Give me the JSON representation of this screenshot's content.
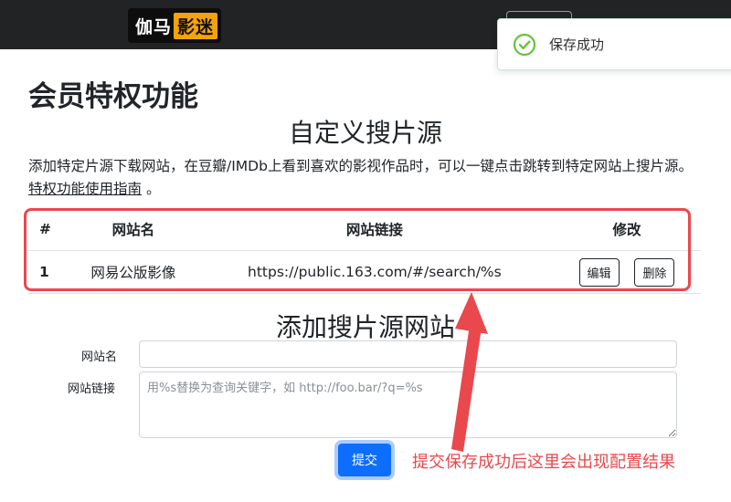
{
  "navbar": {
    "logo_part1": "伽马",
    "logo_part2": "影迷"
  },
  "toast": {
    "message": "保存成功",
    "icon": "check-circle-icon",
    "color": "#67c23a"
  },
  "page": {
    "title": "会员特权功能",
    "section_title": "自定义搜片源",
    "description": "添加特定片源下载网站，在豆瓣/IMDb上看到喜欢的影视作品时，可以一键点击跳转到特定网站上搜片源。",
    "guide_link": "特权功能使用指南",
    "guide_suffix": "。"
  },
  "table": {
    "headers": [
      "#",
      "网站名",
      "网站链接",
      "修改"
    ],
    "rows": [
      {
        "num": "1",
        "name": "网易公版影像",
        "url": "https://public.163.com/#/search/%s",
        "edit": "编辑",
        "delete": "删除"
      }
    ]
  },
  "form": {
    "title": "添加搜片源网站",
    "name_label": "网站名",
    "name_value": "",
    "url_label": "网站链接",
    "url_placeholder": "用%s替换为查询关键字，如 http://foo.bar/?q=%s",
    "submit": "提交"
  },
  "annotation": {
    "text": "提交保存成功后这里会出现配置结果",
    "color": "#e9484d"
  },
  "colors": {
    "navbar": "#222324",
    "logo_accent": "#f6a20b",
    "primary": "#0d6efd",
    "highlight": "#e9484d"
  }
}
